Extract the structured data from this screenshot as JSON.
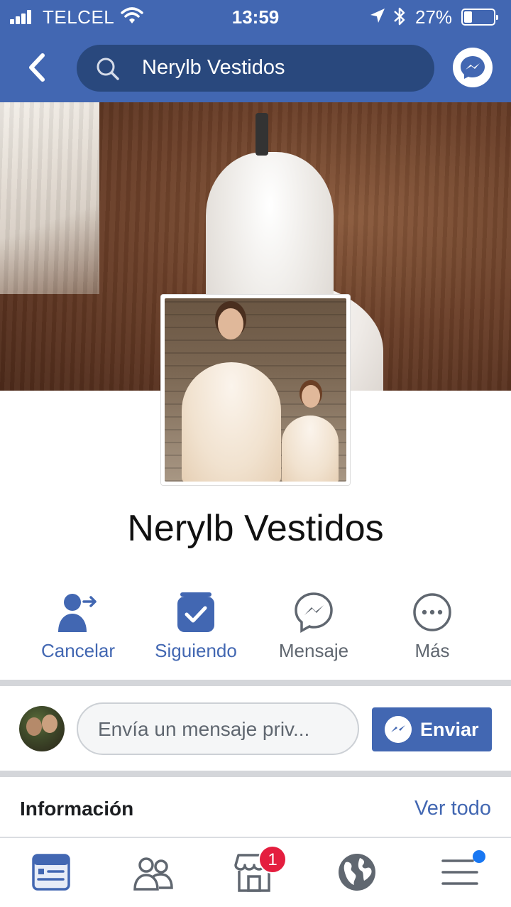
{
  "status_bar": {
    "carrier": "TELCEL",
    "time": "13:59",
    "battery_percent": "27%",
    "battery_level": 0.27
  },
  "header": {
    "search_text": "Nerylb Vestidos"
  },
  "page": {
    "name": "Nerylb Vestidos"
  },
  "actions": [
    {
      "label": "Cancelar",
      "icon": "user-arrow-icon",
      "color": "#4267b2"
    },
    {
      "label": "Siguiendo",
      "icon": "following-check-icon",
      "color": "#4267b2"
    },
    {
      "label": "Mensaje",
      "icon": "messenger-icon",
      "color": "#606770"
    },
    {
      "label": "Más",
      "icon": "more-dots-icon",
      "color": "#606770"
    }
  ],
  "message": {
    "placeholder": "Envía un mensaje priv...",
    "send_label": "Enviar"
  },
  "info": {
    "title": "Información",
    "see_all": "Ver todo"
  },
  "tabbar": {
    "items": [
      {
        "icon": "news-feed-icon",
        "active": true
      },
      {
        "icon": "friends-icon",
        "active": false
      },
      {
        "icon": "marketplace-icon",
        "active": false,
        "badge": "1"
      },
      {
        "icon": "globe-icon",
        "active": false
      },
      {
        "icon": "menu-icon",
        "active": false
      }
    ]
  },
  "colors": {
    "brand": "#4267b2",
    "search_bg": "#29487d",
    "badge": "#e41e3f"
  }
}
